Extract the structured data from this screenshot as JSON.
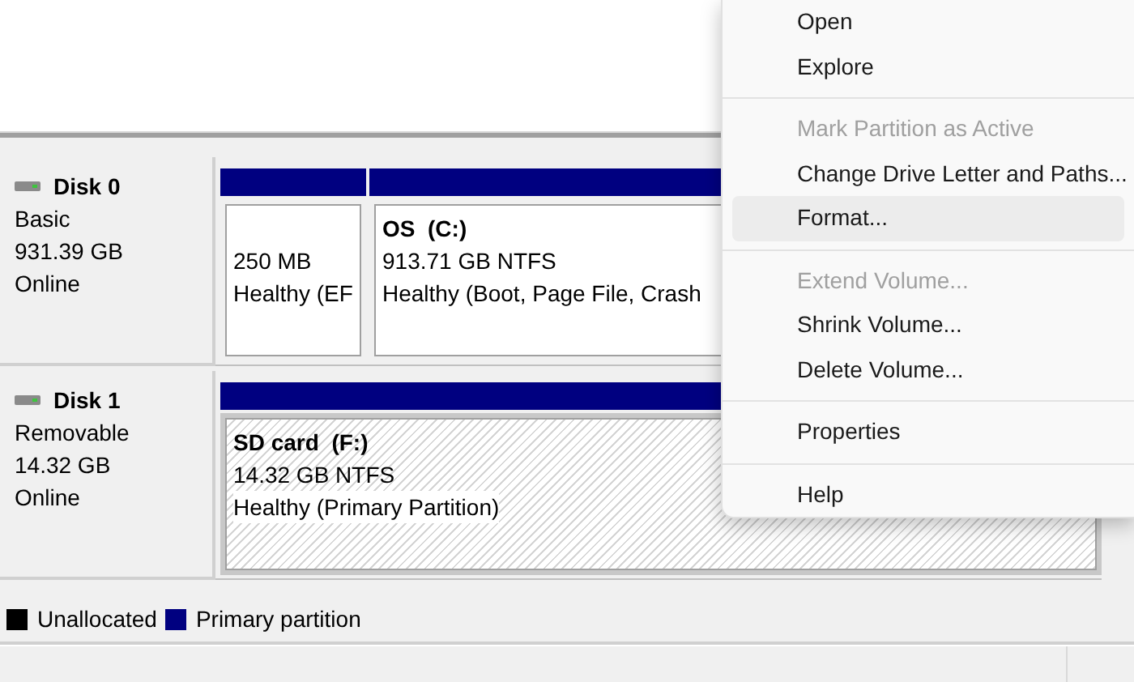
{
  "disks": [
    {
      "name": "Disk 0",
      "type": "Basic",
      "size": "931.39 GB",
      "status": "Online",
      "partitions": [
        {
          "kind": "plain",
          "size": "250 MB",
          "health": "Healthy (EF",
          "selected": false
        },
        {
          "kind": "plain",
          "title": "OS  (C:)",
          "size": "913.71 GB NTFS",
          "health": "Healthy (Boot, Page File, Crash",
          "selected": false
        }
      ]
    },
    {
      "name": "Disk 1",
      "type": "Removable",
      "size": "14.32 GB",
      "status": "Online",
      "partitions": [
        {
          "kind": "hatched",
          "title": "SD card  (F:)",
          "size": "14.32 GB NTFS",
          "health": "Healthy (Primary Partition)",
          "selected": true
        }
      ]
    }
  ],
  "legend": [
    {
      "label": "Unallocated",
      "color": "#000000"
    },
    {
      "label": "Primary partition",
      "color": "#000080"
    }
  ],
  "context_menu": [
    {
      "kind": "item",
      "label": "Open",
      "disabled": false,
      "selected": false
    },
    {
      "kind": "item",
      "label": "Explore",
      "disabled": false,
      "selected": false
    },
    {
      "kind": "separator"
    },
    {
      "kind": "item",
      "label": "Mark Partition as Active",
      "disabled": true,
      "selected": false
    },
    {
      "kind": "item",
      "label": "Change Drive Letter and Paths...",
      "disabled": false,
      "selected": false
    },
    {
      "kind": "item",
      "label": "Format...",
      "disabled": false,
      "selected": true
    },
    {
      "kind": "separator"
    },
    {
      "kind": "item",
      "label": "Extend Volume...",
      "disabled": true,
      "selected": false
    },
    {
      "kind": "item",
      "label": "Shrink Volume...",
      "disabled": false,
      "selected": false
    },
    {
      "kind": "item",
      "label": "Delete Volume...",
      "disabled": false,
      "selected": false
    },
    {
      "kind": "separator"
    },
    {
      "kind": "item",
      "label": "Properties",
      "disabled": false,
      "selected": false
    },
    {
      "kind": "separator"
    },
    {
      "kind": "item",
      "label": "Help",
      "disabled": false,
      "selected": false
    }
  ]
}
